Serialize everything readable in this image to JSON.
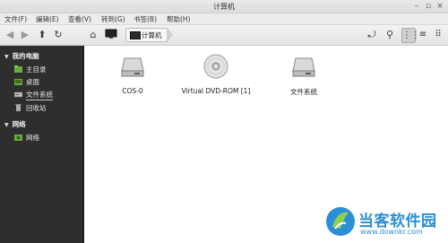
{
  "window": {
    "title": "计算机"
  },
  "menubar": {
    "items": [
      "文件(F)",
      "编辑(E)",
      "查看(V)",
      "转到(G)",
      "书签(B)",
      "帮助(H)"
    ]
  },
  "toolbar": {
    "path_label": "计算机"
  },
  "sidebar": {
    "sections": [
      {
        "title": "我的电脑",
        "items": [
          "主目录",
          "桌面",
          "文件系统",
          "回收站"
        ],
        "selected": "文件系统"
      },
      {
        "title": "网络",
        "items": [
          "网络"
        ]
      }
    ]
  },
  "files": [
    {
      "label": "COS-0",
      "icon": "hard-drive-icon"
    },
    {
      "label": "Virtual DVD-ROM [1]",
      "icon": "optical-disc-icon"
    },
    {
      "label": "文件系统",
      "icon": "hard-drive-icon"
    }
  ],
  "watermark": {
    "text": "当客软件园",
    "url": "www.downkr.com"
  },
  "colors": {
    "sidebar_bg": "#2e2e2e",
    "accent": "#2a8fd6",
    "folder_green": "#6cab3e"
  }
}
